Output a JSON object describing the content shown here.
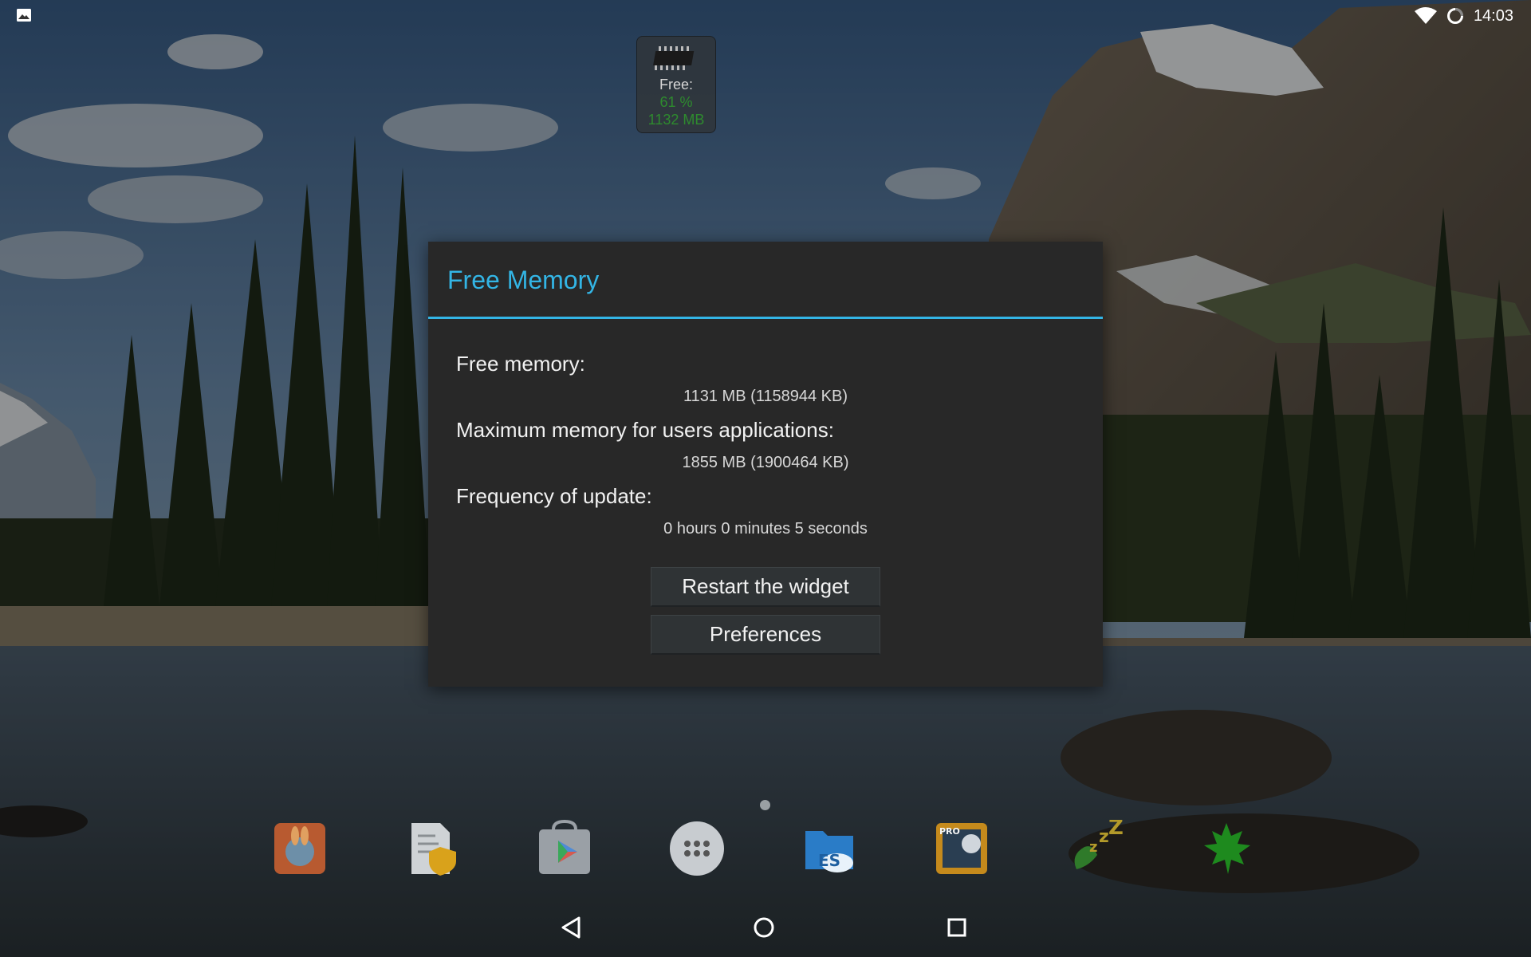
{
  "statusbar": {
    "time": "14:03",
    "left_icon": "image-notification-icon",
    "right_icons": [
      "wifi-icon",
      "sync-icon"
    ]
  },
  "widget": {
    "icon": "memory-chip-icon",
    "label": "Free:",
    "percent": "61 %",
    "amount": "1132 MB",
    "value_color": "#2e8b2e"
  },
  "dialog": {
    "title": "Free Memory",
    "accent_color": "#33b5e5",
    "rows": [
      {
        "label": "Free memory:",
        "value": "1131 MB (1158944 KB)"
      },
      {
        "label": "Maximum memory for users applications:",
        "value": "1855 MB (1900464 KB)"
      },
      {
        "label": "Frequency of update:",
        "value": "0 hours 0 minutes 5 seconds"
      }
    ],
    "buttons": {
      "restart": "Restart the widget",
      "preferences": "Preferences"
    }
  },
  "dock": {
    "apps": [
      "rabbit-app-icon",
      "document-shield-icon",
      "play-store-icon",
      "app-drawer-icon",
      "es-file-explorer-icon",
      "video-pro-icon",
      "sleep-zzz-icon",
      "maple-leaf-icon"
    ]
  },
  "navbar": {
    "buttons": [
      "back-icon",
      "home-icon",
      "recents-icon"
    ]
  }
}
